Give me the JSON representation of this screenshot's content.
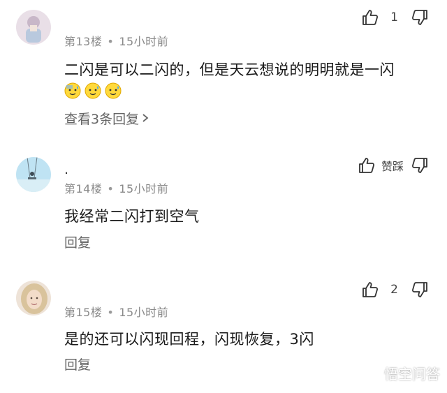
{
  "comments": [
    {
      "username": "",
      "floor": "第13楼",
      "time": "15小时前",
      "content": "二闪是可以二闪的，但是天云想说的明明就是一闪",
      "emojis": [
        "sweat-smile-emoji",
        "sweat-smile-emoji",
        "sweat-smile-emoji"
      ],
      "reply_link": "查看3条回复",
      "like_count": "1"
    },
    {
      "username": ".",
      "floor": "第14楼",
      "time": "15小时前",
      "content": "我经常二闪打到空气",
      "reply_link": "回复",
      "like_text": "赞踩"
    },
    {
      "username": "",
      "floor": "第15楼",
      "time": "15小时前",
      "content": "是的还可以闪现回程，闪现恢复，3闪",
      "reply_link": "回复",
      "like_count": "2"
    }
  ],
  "separator": "•",
  "watermark": "悟空问答",
  "colors": {
    "text": "#1a1a1a",
    "meta": "#8a8a8a",
    "icon": "#333333"
  }
}
